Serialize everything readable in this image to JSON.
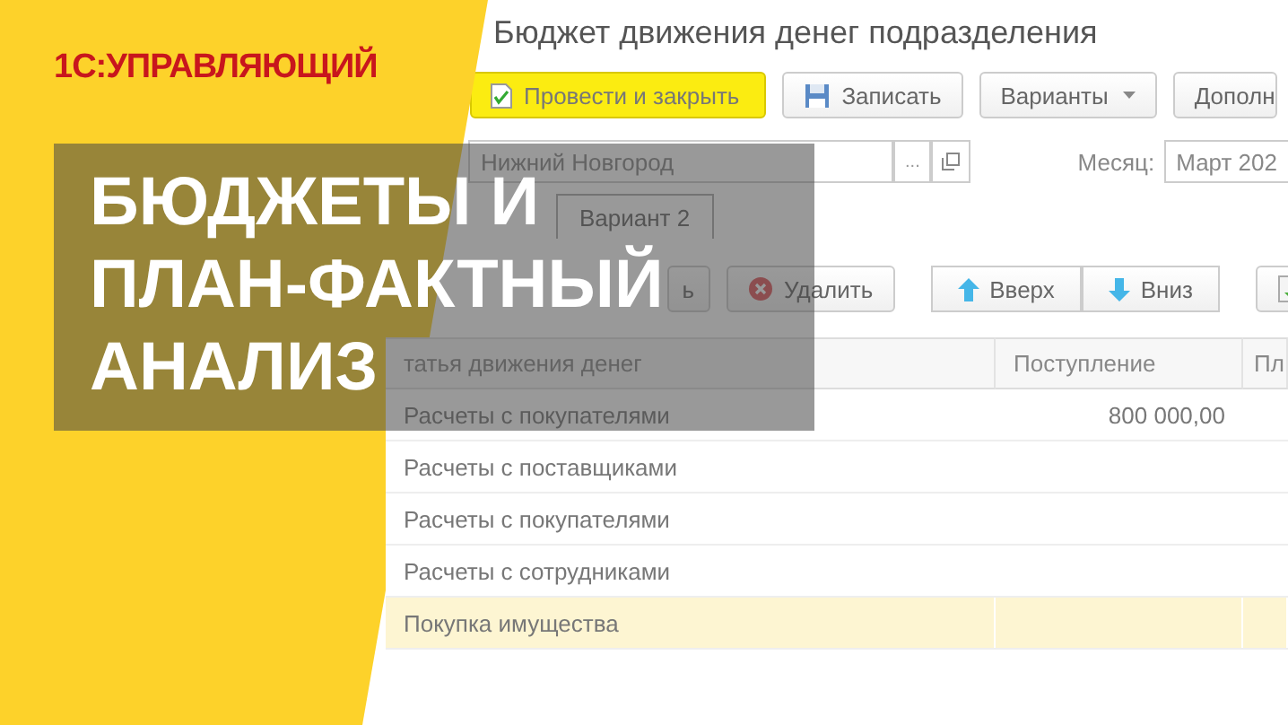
{
  "brand": "1С:УПРАВЛЯЮЩИЙ",
  "headline": [
    "БЮДЖЕТЫ И",
    "ПЛАН-ФАКТНЫЙ",
    "АНАЛИЗ"
  ],
  "window": {
    "title": "Бюджет движения денег подразделения"
  },
  "toolbar": [
    {
      "kind": "primary",
      "label": "Провести и закрыть"
    },
    {
      "kind": "save",
      "label": "Записать"
    },
    {
      "kind": "menu",
      "label": "Варианты"
    },
    {
      "kind": "plain",
      "label": "Дополн"
    }
  ],
  "unit_field": {
    "value": "Нижний Новгород",
    "select_button": "..."
  },
  "month_field": {
    "label": "Месяц:",
    "value": "Март 202"
  },
  "tabs": [
    {
      "label": "Вариант 2",
      "selected": true
    }
  ],
  "table_toolbar": [
    {
      "kind": "plain",
      "label": "ь"
    },
    {
      "kind": "delete",
      "label": "Удалить"
    },
    {
      "kind": "up",
      "label": "Вверх"
    },
    {
      "kind": "down",
      "label": "Вниз"
    },
    {
      "kind": "import"
    }
  ],
  "table": {
    "columns": [
      "татья движения денег",
      "Поступление",
      "Пл"
    ],
    "rows": [
      {
        "item": "Расчеты с покупателями",
        "income": "800 000,00",
        "selected": false
      },
      {
        "item": "Расчеты с поставщиками",
        "selected": false
      },
      {
        "item": "Расчеты с покупателями",
        "selected": false
      },
      {
        "item": "Расчеты с сотрудниками",
        "selected": false
      },
      {
        "item": "Покупка имущества",
        "selected": true
      }
    ]
  }
}
